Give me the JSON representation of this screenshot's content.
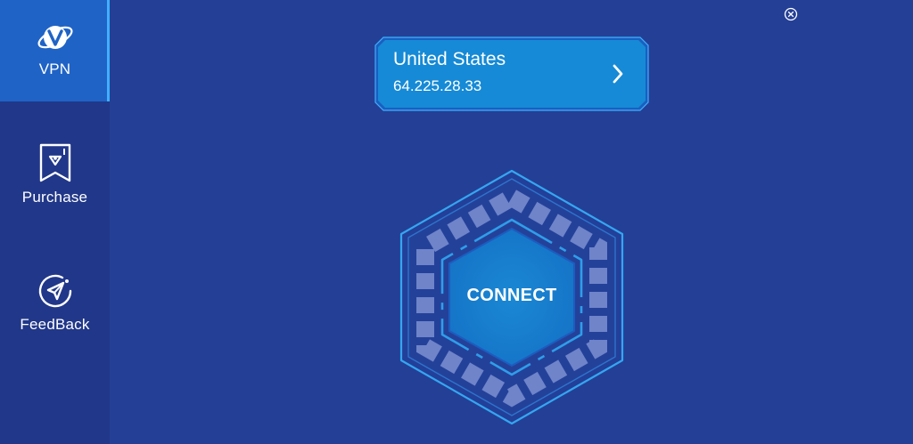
{
  "sidebar": {
    "items": [
      {
        "label": "VPN",
        "icon": "vpn-logo-icon",
        "active": true
      },
      {
        "label": "Purchase",
        "icon": "bookmark-tag-icon",
        "active": false
      },
      {
        "label": "FeedBack",
        "icon": "paper-plane-icon",
        "active": false
      }
    ]
  },
  "window": {
    "close_icon": "close-icon"
  },
  "location": {
    "country": "United States",
    "ip": "64.225.28.33",
    "chevron_icon": "chevron-right-icon"
  },
  "connect": {
    "label": "CONNECT"
  },
  "colors": {
    "background": "#243f96",
    "sidebar": "#213789",
    "active_nav": "#1f63c6",
    "card": "#168ad6",
    "accent": "#3fb0ff"
  }
}
